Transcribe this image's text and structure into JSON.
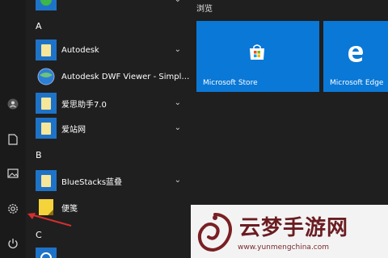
{
  "start_menu": {
    "rail": {
      "icons": [
        "user-icon",
        "document-icon",
        "pictures-icon",
        "settings-icon",
        "power-icon"
      ]
    },
    "app_list": {
      "top_item": {
        "label": "",
        "has_chevron": true
      },
      "groups": [
        {
          "letter": "A",
          "items": [
            {
              "label": "Autodesk",
              "icon": "folder-icon",
              "has_chevron": true
            },
            {
              "label": "Autodesk DWF Viewer - Simplifie...",
              "icon": "dwf-viewer-icon",
              "has_chevron": false
            },
            {
              "label": "爱思助手7.0",
              "icon": "folder-icon",
              "has_chevron": true
            },
            {
              "label": "爱站网",
              "icon": "folder-icon",
              "has_chevron": true
            }
          ]
        },
        {
          "letter": "B",
          "items": [
            {
              "label": "BlueStacks蓝叠",
              "icon": "folder-icon",
              "has_chevron": true
            },
            {
              "label": "便笺",
              "icon": "sticky-notes-icon",
              "has_chevron": false
            }
          ]
        },
        {
          "letter": "C",
          "items": [
            {
              "label": "",
              "icon": "blue-circle-icon",
              "has_chevron": false
            }
          ]
        }
      ]
    },
    "tiles": {
      "header": "浏览",
      "items": [
        {
          "label": "Microsoft Store",
          "icon": "store-icon"
        },
        {
          "label": "Microsoft Edge",
          "icon": "edge-icon"
        }
      ]
    }
  },
  "watermark": {
    "title": "云梦手游网",
    "url": "www.yunmengchina.com"
  },
  "colors": {
    "tile_blue": "#0a78d6",
    "folder_yellow": "#f7e79a",
    "arrow_red": "#d32f2f"
  }
}
